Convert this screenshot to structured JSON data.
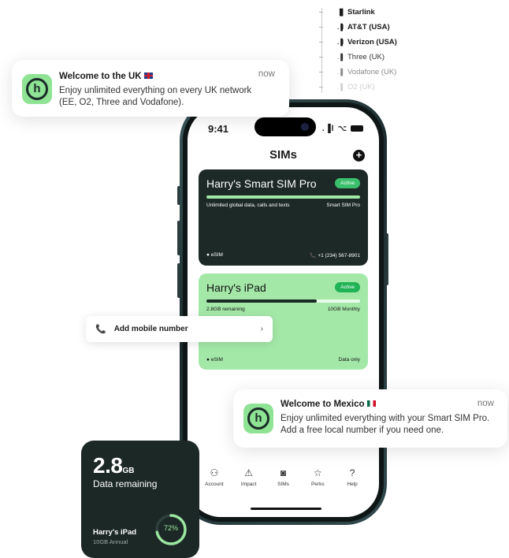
{
  "networks": [
    {
      "bars": "▐▌",
      "name": "Starlink"
    },
    {
      "bars": ".▐l",
      "name": "AT&T (USA)"
    },
    {
      "bars": ".▐l",
      "name": "Verizon (USA)"
    },
    {
      "bars": ".▐l",
      "name": "Three (UK)"
    },
    {
      "bars": ".▐l",
      "name": "Vodafone (UK)"
    },
    {
      "bars": ".▐l",
      "name": "O2 (UK)"
    }
  ],
  "notification_uk": {
    "title": "Welcome to the UK",
    "time": "now",
    "body": "Enjoy unlimited everything on every UK network (EE, O2, Three and Vodafone)."
  },
  "notification_mx": {
    "title": "Welcome to Mexico",
    "time": "now",
    "body": "Enjoy unlimited everything with your Smart SIM Pro. Add a free local number if you need one."
  },
  "logo_letter": "h",
  "phone": {
    "time": "9:41",
    "signal": ".▐l",
    "wifi": "⌥",
    "title": "SIMs",
    "add": "+"
  },
  "sim_pro": {
    "name": "Harry's Smart SIM Pro",
    "status": "Active",
    "description": "Unlimited global data, calls and texts",
    "plan": "Smart SIM Pro",
    "type": "eSIM",
    "number": "+1 (234) 567-8901"
  },
  "sim_ipad": {
    "name": "Harry's iPad",
    "status": "Active",
    "remaining": "2.8GB remaining",
    "plan": "10GB Monthly",
    "type": "eSIM",
    "data_type": "Data only",
    "usage_fraction": 0.72
  },
  "add_number": {
    "label": "Add mobile number",
    "chevron": "›"
  },
  "tabs": [
    {
      "icon": "⚇",
      "label": "Account"
    },
    {
      "icon": "⚠",
      "label": "Impact"
    },
    {
      "icon": "◙",
      "label": "SIMs"
    },
    {
      "icon": "☆",
      "label": "Perks"
    },
    {
      "icon": "?",
      "label": "Help"
    }
  ],
  "widget": {
    "amount": "2.8",
    "unit": "GB",
    "label": "Data remaining",
    "device": "Harry's iPad",
    "plan": "10GB Annual",
    "percent": "72%",
    "percent_value": 0.72
  },
  "colors": {
    "brand_green": "#8fe394",
    "dark": "#1c2826",
    "active": "#3cbf6c"
  }
}
